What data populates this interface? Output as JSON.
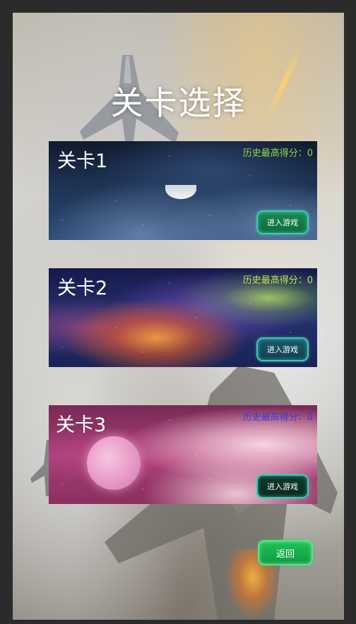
{
  "page": {
    "title": "关卡选择"
  },
  "levels": [
    {
      "name": "关卡1",
      "high_score_label": "历史最高得分：0",
      "enter_label": "进入游戏"
    },
    {
      "name": "关卡2",
      "high_score_label": "历史最高得分：0",
      "enter_label": "进入游戏"
    },
    {
      "name": "关卡3",
      "high_score_label": "历史最高得分：0",
      "enter_label": "进入游戏"
    }
  ],
  "footer": {
    "back_label": "返回"
  },
  "colors": {
    "score_level1": "#8fd54b",
    "score_level2": "#c7e05a",
    "score_level3": "#3b3bd6",
    "button_green": "#1c8a55",
    "border_cyan": "#39c9b6"
  },
  "icons": [
    "fighter-jet-icon",
    "moon-icon"
  ]
}
